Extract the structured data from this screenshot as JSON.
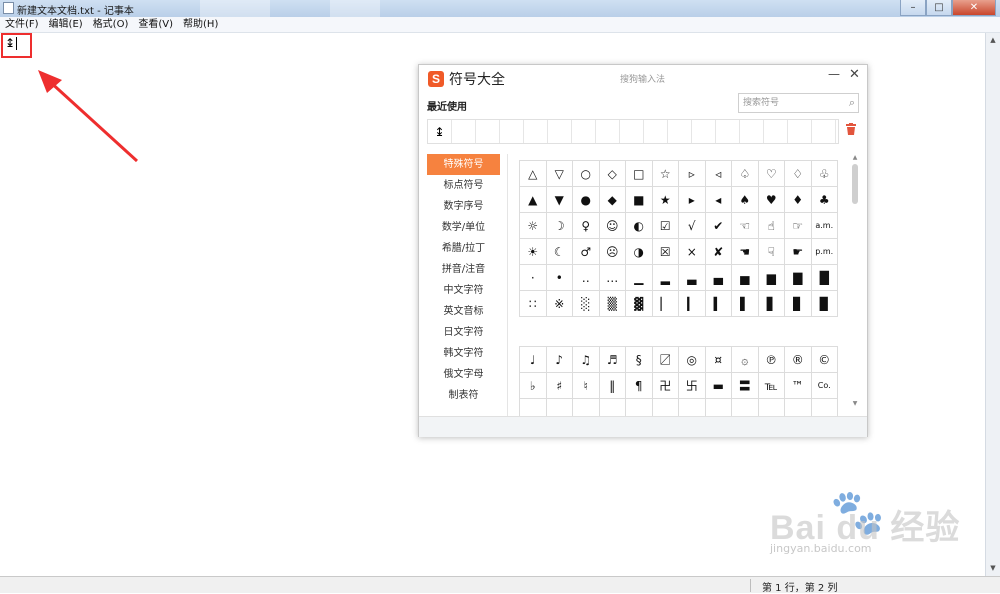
{
  "window": {
    "title": "新建文本文档.txt - 记事本",
    "minimize": "–",
    "maximize": "□",
    "close": "✕"
  },
  "menu": [
    "文件(F)",
    "编辑(E)",
    "格式(O)",
    "查看(V)",
    "帮助(H)"
  ],
  "editor": {
    "content": "↨"
  },
  "status": {
    "position": "第 1 行，第 2 列"
  },
  "panel": {
    "logo": "S",
    "title": "符号大全",
    "subtitle": "搜狗输入法",
    "minimize": "—",
    "close": "✕",
    "recent_label": "最近使用",
    "search_placeholder": "搜索符号",
    "search_icon": "⌕",
    "trash_icon": "🗑",
    "recent": [
      "↨",
      "",
      "",
      "",
      "",
      "",
      "",
      "",
      "",
      "",
      "",
      "",
      "",
      "",
      "",
      "",
      ""
    ],
    "categories": [
      "特殊符号",
      "标点符号",
      "数字序号",
      "数学/单位",
      "希腊/拉丁",
      "拼音/注音",
      "中文字符",
      "英文音标",
      "日文字符",
      "韩文字符",
      "俄文字母",
      "制表符"
    ],
    "active_category": 0,
    "grid1": [
      [
        "△",
        "▽",
        "○",
        "◇",
        "□",
        "☆",
        "▹",
        "◃",
        "♤",
        "♡",
        "♢",
        "♧"
      ],
      [
        "▲",
        "▼",
        "●",
        "◆",
        "■",
        "★",
        "▸",
        "◂",
        "♠",
        "♥",
        "♦",
        "♣"
      ],
      [
        "☼",
        "☽",
        "♀",
        "☺",
        "◐",
        "☑",
        "√",
        "✔",
        "☜",
        "☝",
        "☞",
        "a.m."
      ],
      [
        "☀",
        "☾",
        "♂",
        "☹",
        "◑",
        "☒",
        "×",
        "✘",
        "☚",
        "☟",
        "☛",
        "p.m."
      ],
      [
        "·",
        "•",
        "‥",
        "…",
        "▁",
        "▂",
        "▃",
        "▄",
        "▅",
        "▆",
        "▇",
        "█"
      ],
      [
        "∷",
        "※",
        "░",
        "▒",
        "▓",
        "▏",
        "▎",
        "▍",
        "▌",
        "▋",
        "▊",
        "▉"
      ]
    ],
    "grid2": [
      [
        "♩",
        "♪",
        "♫",
        "♬",
        "§",
        "〼",
        "◎",
        "¤",
        "۞",
        "℗",
        "®",
        "©"
      ],
      [
        "♭",
        "♯",
        "♮",
        "‖",
        "¶",
        "卍",
        "卐",
        "▬",
        "〓",
        "℡",
        "™",
        "Co."
      ],
      [
        "",
        "",
        "",
        "",
        "",
        "",
        "",
        "",
        "",
        "",
        "",
        ""
      ]
    ]
  },
  "watermark": {
    "brand": "Bai du 经验",
    "url": "jingyan.baidu.com"
  }
}
